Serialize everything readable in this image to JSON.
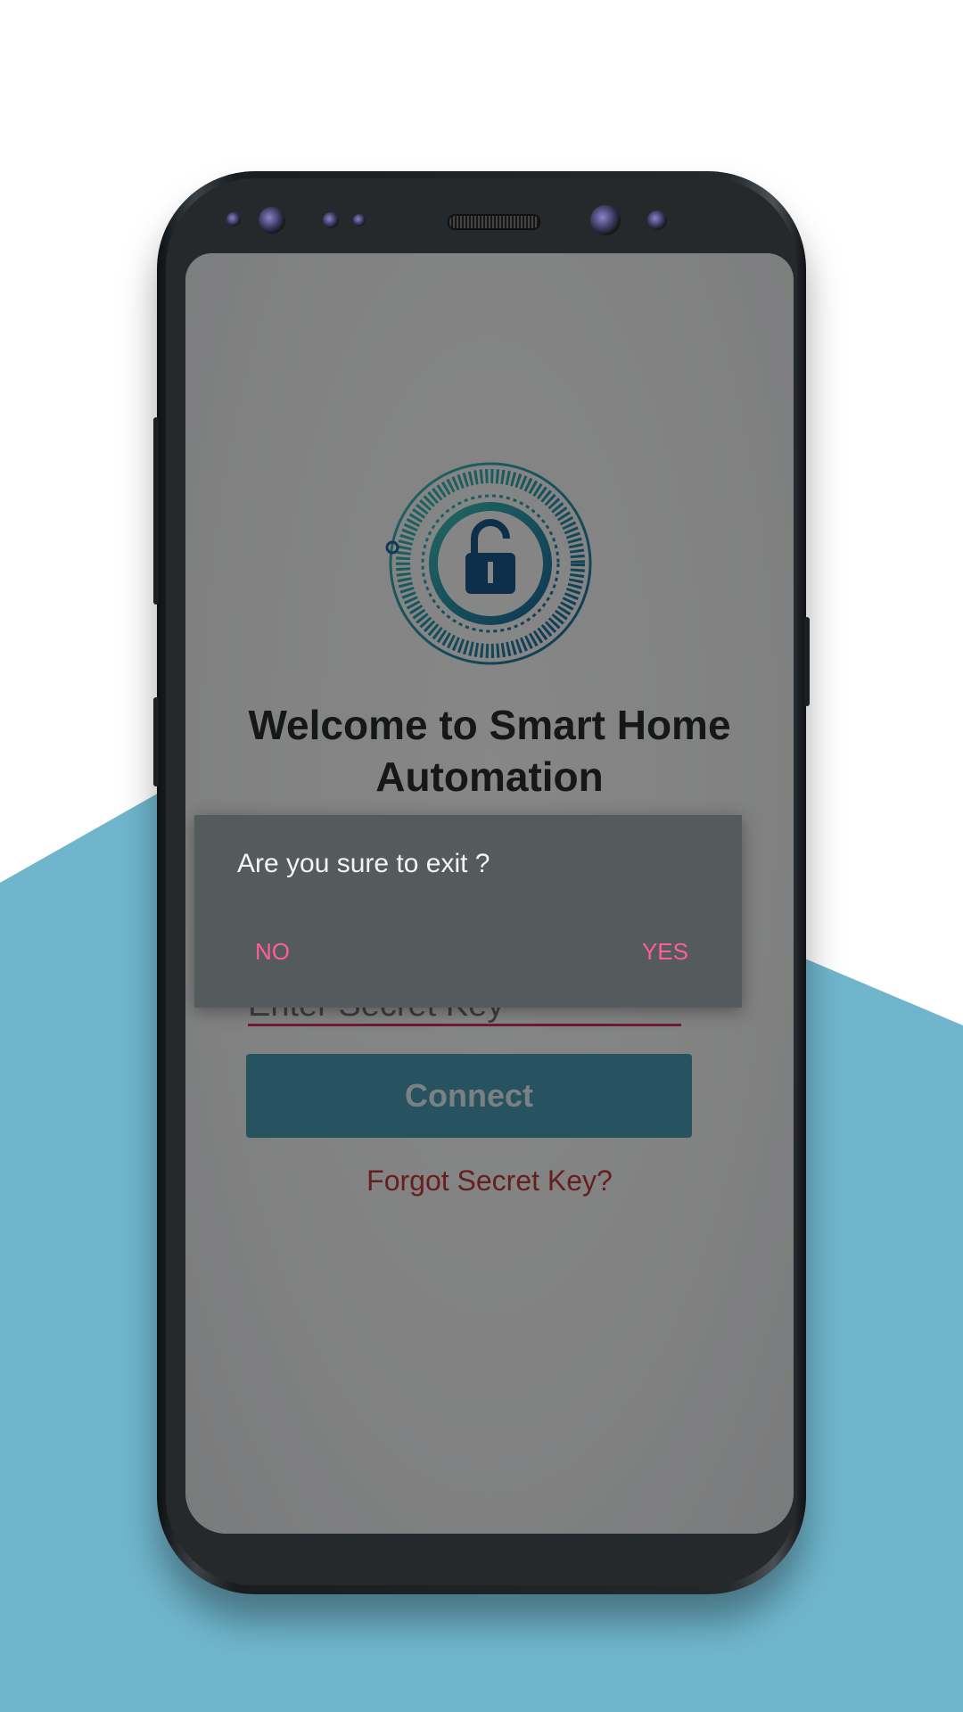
{
  "colors": {
    "background": "#ffffff",
    "accent_band": "#6fb5cc",
    "connect_button": "#4a9bb6",
    "input_underline": "#d6316a",
    "forgot_link": "#c23a3a",
    "dialog_action": "#ff5c9a",
    "dialog_background": "#555a5c"
  },
  "app": {
    "logo_icon": "lock-dial-icon",
    "welcome_title": "Welcome to Smart Home Automation",
    "secret_key_placeholder": "Enter Secret Key",
    "connect_label": "Connect",
    "forgot_label": "Forgot Secret Key?"
  },
  "dialog": {
    "message": "Are you sure to exit ?",
    "no_label": "NO",
    "yes_label": "YES"
  }
}
